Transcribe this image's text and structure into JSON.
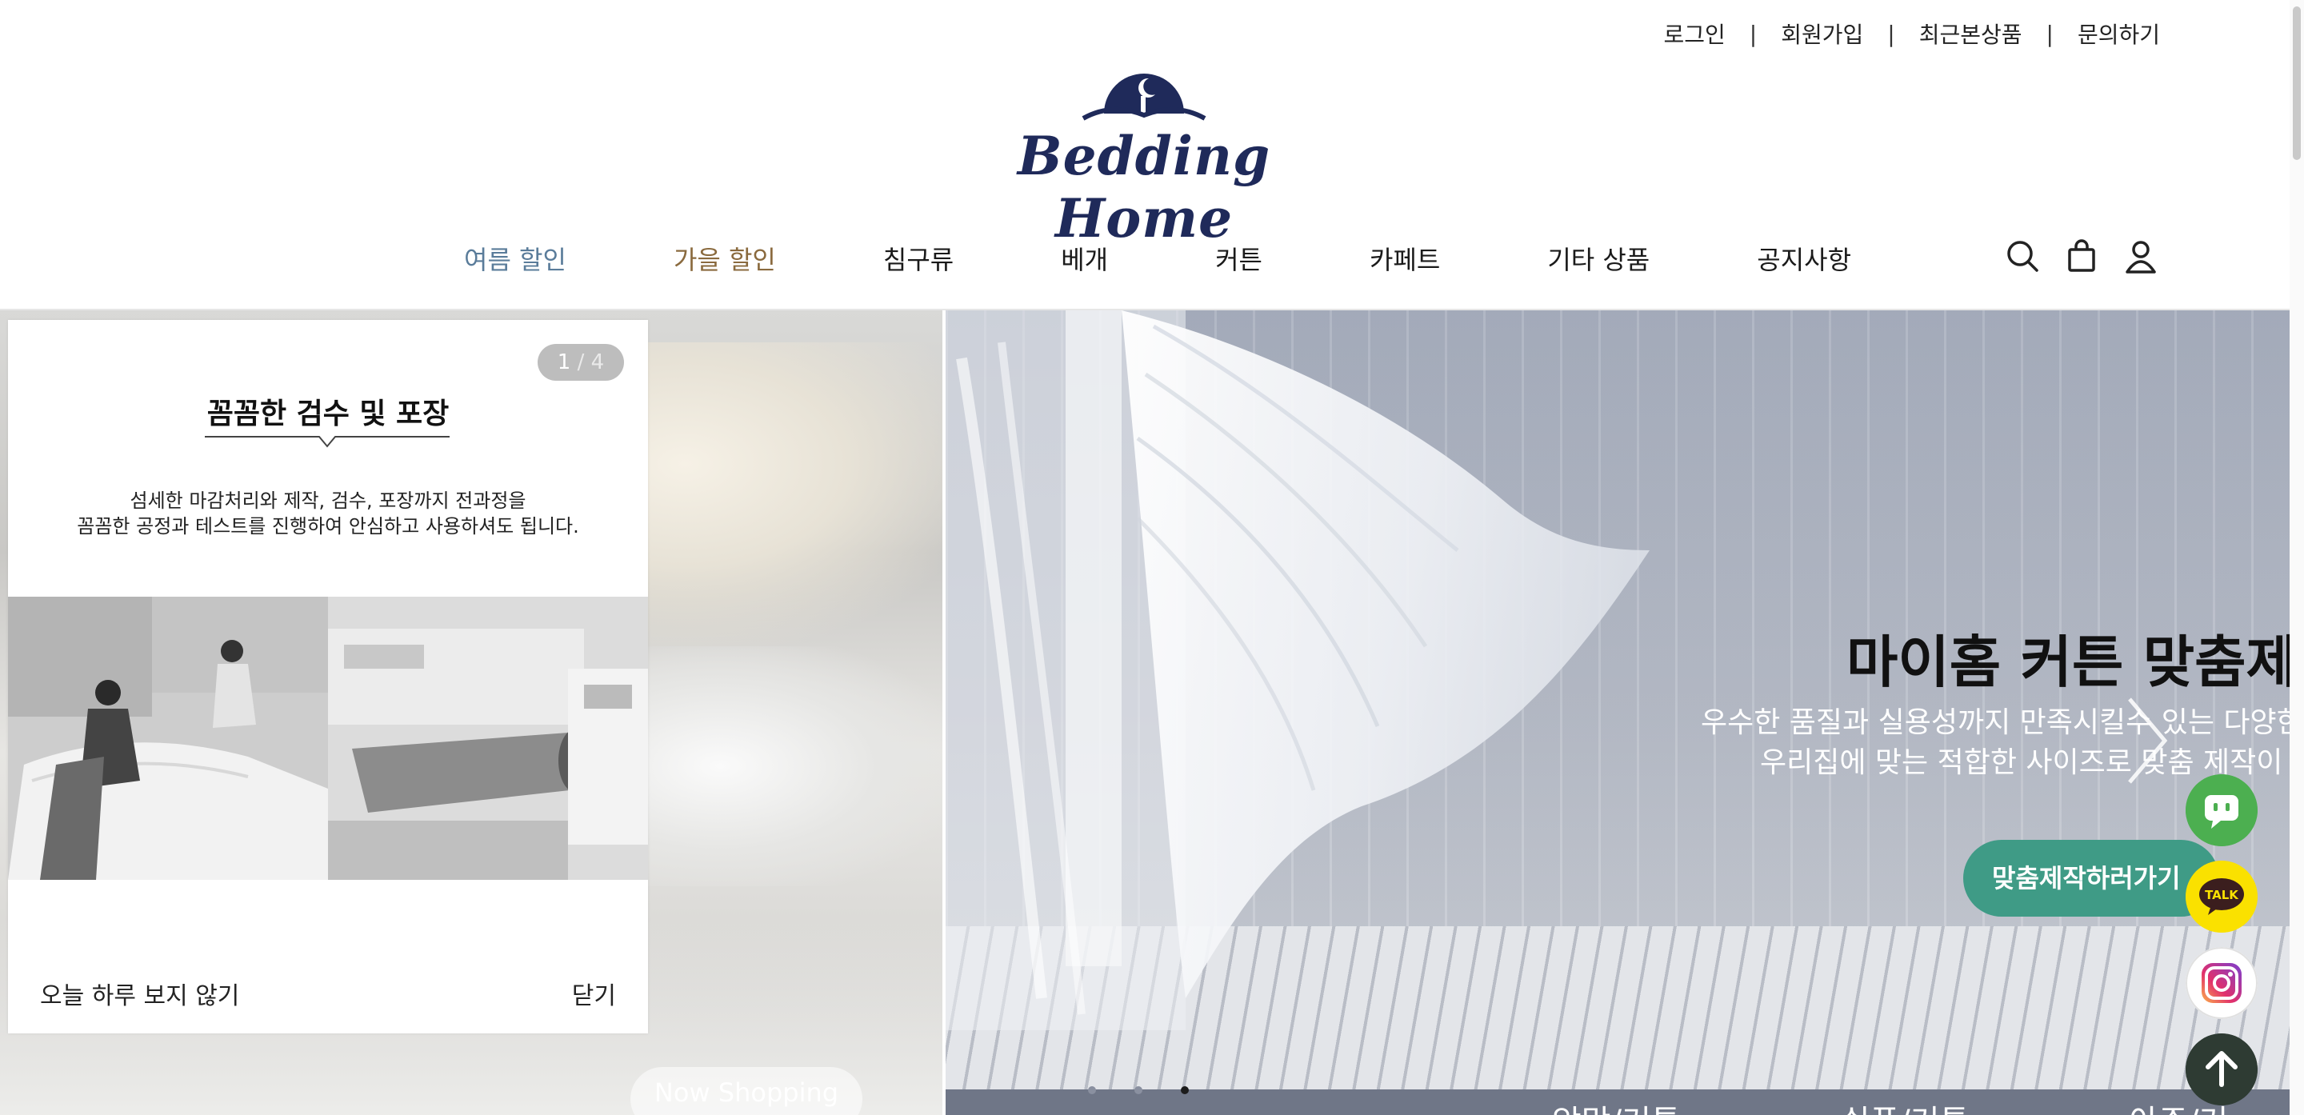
{
  "utility_links": [
    "로그인",
    "회원가입",
    "최근본상품",
    "문의하기"
  ],
  "utility_separator": "|",
  "brand": {
    "name": "Bedding Home",
    "color": "#1f2a5a"
  },
  "nav": {
    "items": [
      "여름 할인",
      "가을 할인",
      "침구류",
      "베개",
      "커튼",
      "카페트",
      "기타 상품",
      "공지사항"
    ],
    "colors": {
      "summer": "#5a7c9a",
      "autumn": "#8a6a3e",
      "default": "#1a1a1a"
    },
    "icons": [
      "search-icon",
      "cart-icon",
      "user-icon"
    ]
  },
  "hero": {
    "left_button": "Now Shopping",
    "title": "마이홈 커튼 맞춤제",
    "subtitle_line1": "우수한 품질과 실용성까지 만족시킬수 있는 다양한",
    "subtitle_line2": "우리집에 맞는 적합한 사이즈로 맞춤 제작이",
    "cta": "맞춤제작하러가기",
    "cta_color": "#3f9b86",
    "active_dot": 3,
    "dot_count": 3,
    "bottom_tabs": [
      "암막/커튼",
      "쉬폰/커튼",
      "아주/커"
    ]
  },
  "popup": {
    "counter_current": "1",
    "counter_sep": "/",
    "counter_total": "4",
    "title": "꼼꼼한 검수 및 포장",
    "desc_line1": "섬세한 마감처리와 제작, 검수, 포장까지 전과정을",
    "desc_line2": "꼼꼼한 공정과 테스트를 진행하여 안심하고 사용하셔도 됩니다.",
    "hide_today": "오늘 하루 보지 않기",
    "close": "닫기"
  },
  "floating": {
    "chat_color": "#4caf50",
    "talk_label": "TALK",
    "talk_color": "#fae100",
    "top_color": "#2e3b33"
  }
}
